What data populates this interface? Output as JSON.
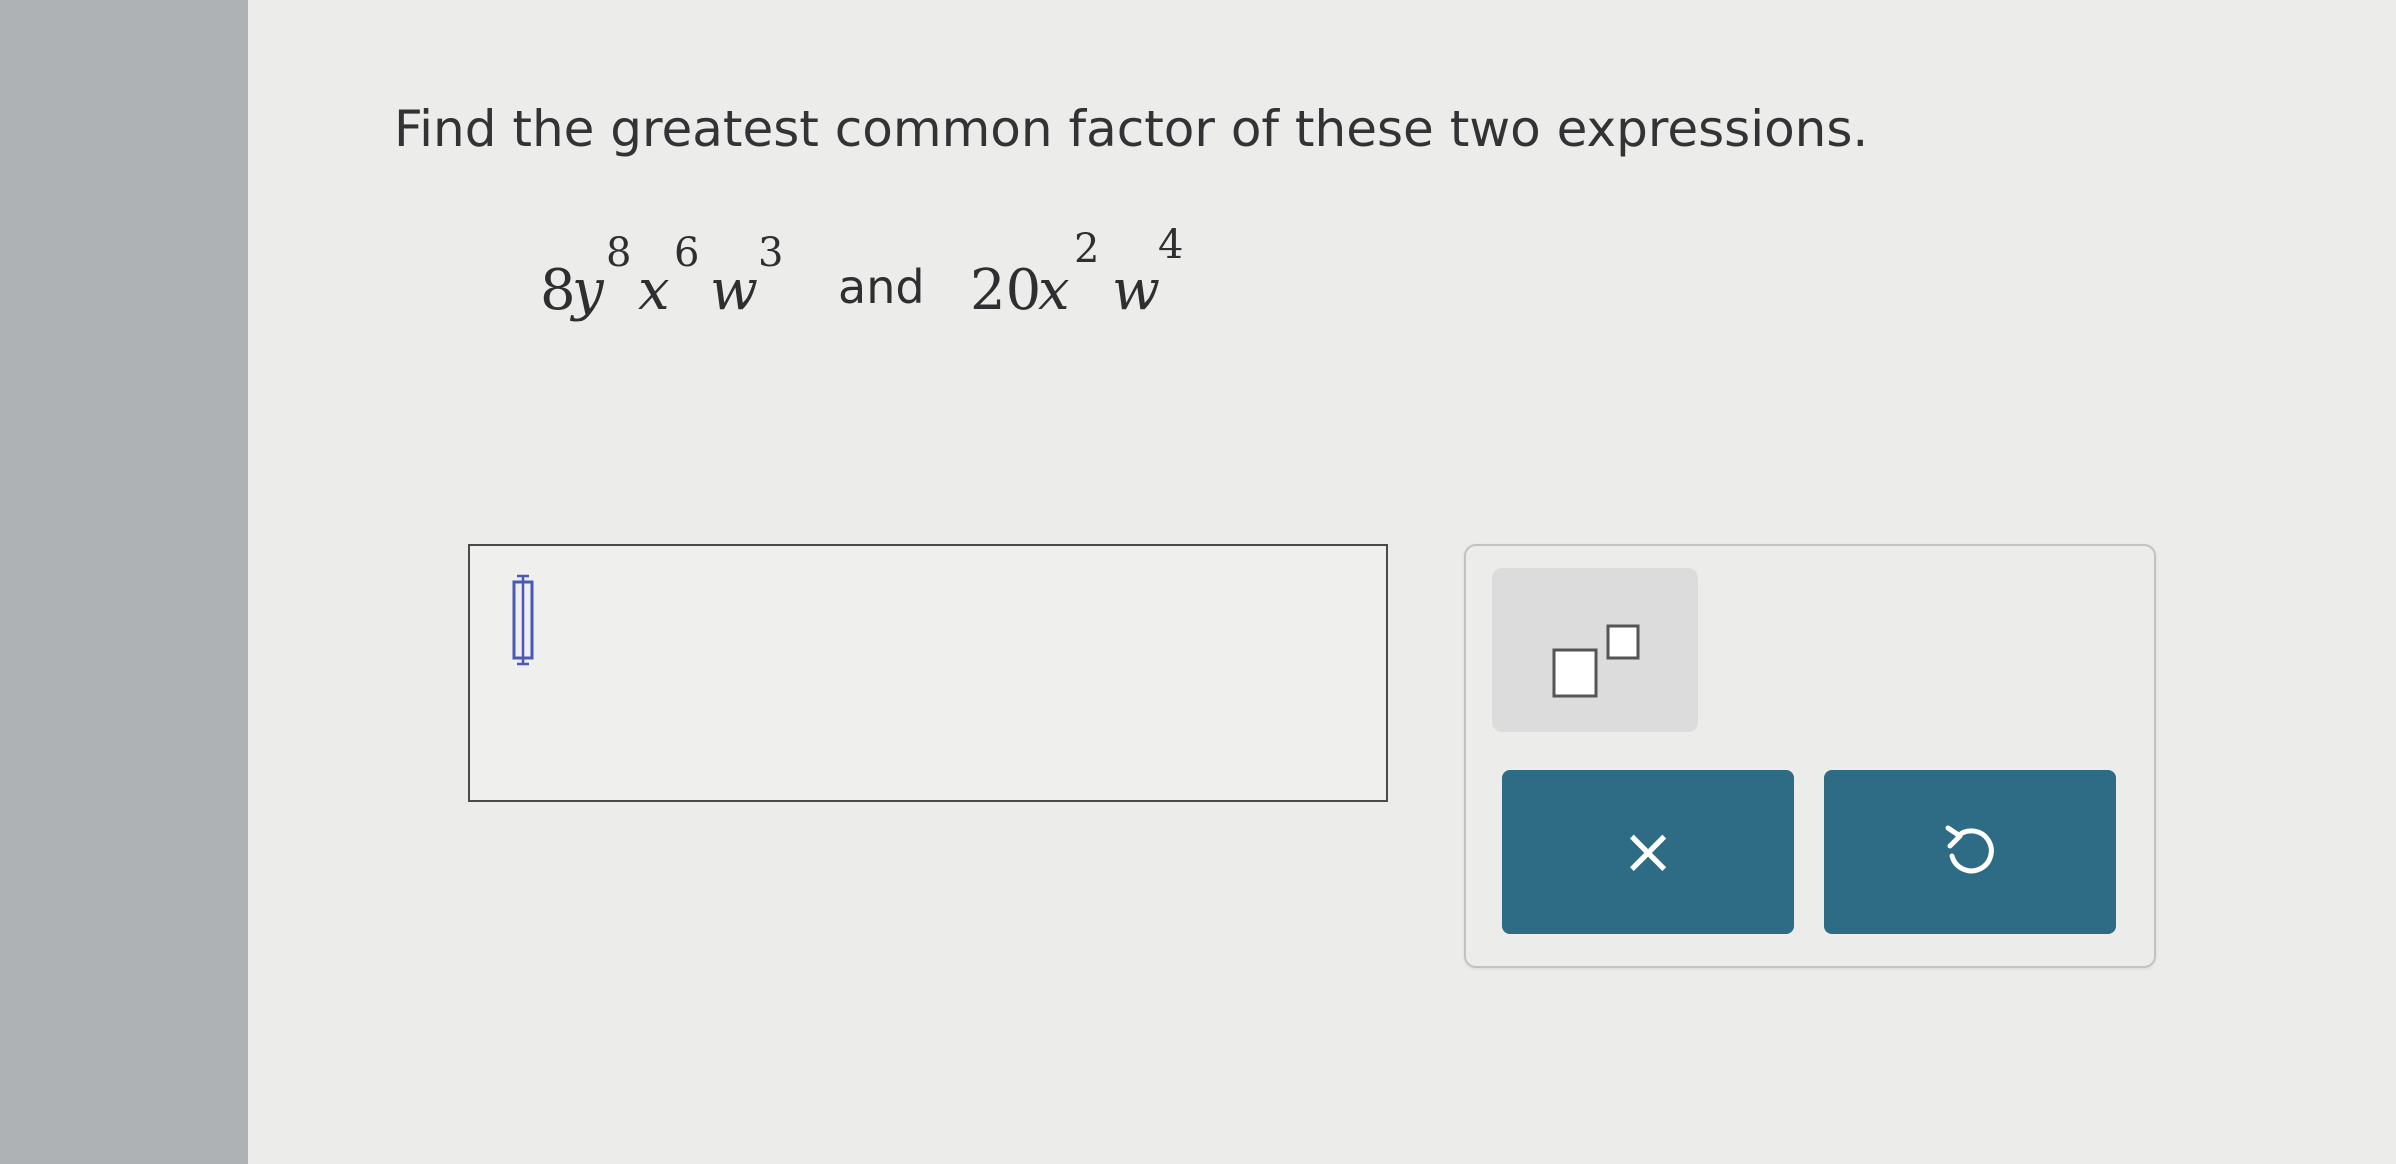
{
  "question": {
    "prompt": "Find the greatest common factor of these two expressions."
  },
  "expression_1": {
    "coefficient": "8",
    "var_1": "y",
    "exp_1": "8",
    "var_2": "x",
    "exp_2": "6",
    "var_3": "w",
    "exp_3": "3"
  },
  "conjunction": "and",
  "expression_2": {
    "coefficient": "20",
    "var_1": "x",
    "exp_1": "2",
    "var_2": "w",
    "exp_2": "4"
  },
  "answer": {
    "value": ""
  },
  "keypad": {
    "exponent_icon": "superscript-template-icon",
    "clear_icon": "close-icon",
    "clear_symbol": "×",
    "undo_icon": "undo-icon"
  },
  "colors": {
    "action_button": "#2e6b84",
    "text": "#333336",
    "cursor": "#4a58b8"
  }
}
